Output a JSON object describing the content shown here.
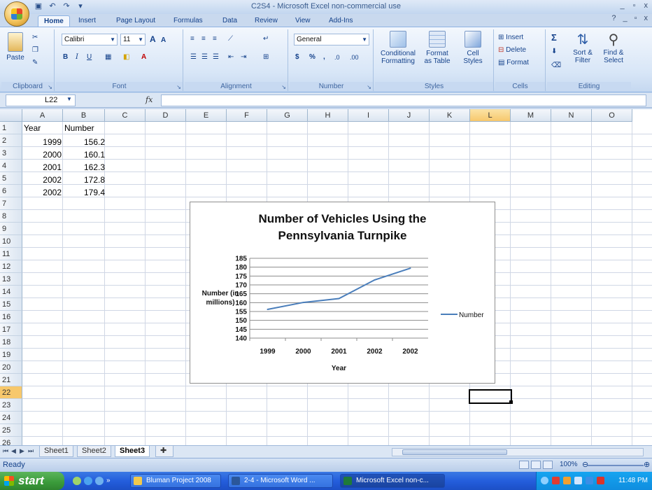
{
  "window": {
    "title": "C2S4 - Microsoft Excel non-commercial use",
    "controls": [
      "_",
      "▫",
      "x"
    ],
    "help_controls": [
      "?",
      "_",
      "▫",
      "x"
    ]
  },
  "ribbon": {
    "tabs": [
      "Home",
      "Insert",
      "Page Layout",
      "Formulas",
      "Data",
      "Review",
      "View",
      "Add-Ins"
    ],
    "active_tab": "Home",
    "clipboard": {
      "label": "Clipboard",
      "paste": "Paste"
    },
    "font": {
      "label": "Font",
      "family": "Calibri",
      "size": "11",
      "bold": "B",
      "italic": "I",
      "underline": "U",
      "grow": "A",
      "shrink": "A"
    },
    "alignment": {
      "label": "Alignment"
    },
    "number": {
      "label": "Number",
      "format": "General",
      "currency": "$",
      "percent": "%",
      "comma": ",",
      "inc_decimal": ".0",
      "dec_decimal": ".00"
    },
    "styles": {
      "label": "Styles",
      "conditional_1": "Conditional",
      "conditional_2": "Formatting",
      "format_table_1": "Format",
      "format_table_2": "as Table",
      "cell_styles_1": "Cell",
      "cell_styles_2": "Styles"
    },
    "cells": {
      "label": "Cells",
      "insert": "Insert",
      "delete": "Delete",
      "format": "Format"
    },
    "editing": {
      "label": "Editing",
      "sigma": "Σ",
      "sort_1": "Sort &",
      "sort_2": "Filter",
      "find_1": "Find &",
      "find_2": "Select"
    }
  },
  "formula_bar": {
    "name_box": "L22",
    "fx": "fx",
    "formula": ""
  },
  "sheet": {
    "columns": [
      "A",
      "B",
      "C",
      "D",
      "E",
      "F",
      "G",
      "H",
      "I",
      "J",
      "K",
      "L",
      "M",
      "N",
      "O"
    ],
    "selected_column": "L",
    "rows": [
      "1",
      "2",
      "3",
      "4",
      "5",
      "6",
      "7",
      "8",
      "9",
      "10",
      "11",
      "12",
      "13",
      "14",
      "15",
      "16",
      "17",
      "18",
      "19",
      "20",
      "21",
      "22",
      "23",
      "24",
      "25",
      "26"
    ],
    "selected_row": "22",
    "header_a": "Year",
    "header_b": "Number",
    "data": [
      {
        "year": "1999",
        "number": "156.2"
      },
      {
        "year": "2000",
        "number": "160.1"
      },
      {
        "year": "2001",
        "number": "162.3"
      },
      {
        "year": "2002",
        "number": "172.8"
      },
      {
        "year": "2002",
        "number": "179.4"
      }
    ]
  },
  "sheet_tabs": [
    "Sheet1",
    "Sheet2",
    "Sheet3"
  ],
  "active_sheet": "Sheet3",
  "status": {
    "ready": "Ready",
    "zoom": "100%"
  },
  "taskbar": {
    "start": "start",
    "tasks": [
      {
        "label": "Bluman Project 2008",
        "active": false
      },
      {
        "label": "2-4 - Microsoft Word ...",
        "active": false
      },
      {
        "label": "Microsoft Excel non-c...",
        "active": true
      }
    ],
    "clock": "11:48 PM"
  },
  "colors": {
    "series_line": "#4a7ebb",
    "active_header": "#f7c86c",
    "accent": "#15428b"
  },
  "chart_data": {
    "type": "line",
    "title_line1": "Number of Vehicles Using the",
    "title_line2": "Pennsylvania Turnpike",
    "xlabel": "Year",
    "ylabel_line1": "Number (in",
    "ylabel_line2": "millions)",
    "categories": [
      "1999",
      "2000",
      "2001",
      "2002",
      "2002"
    ],
    "series": [
      {
        "name": "Number",
        "values": [
          156.2,
          160.1,
          162.3,
          172.8,
          179.4
        ]
      }
    ],
    "yticks": [
      "185",
      "180",
      "175",
      "170",
      "165",
      "160",
      "155",
      "150",
      "145",
      "140"
    ],
    "ylim": [
      140,
      185
    ],
    "legend": "right",
    "grid": true
  }
}
